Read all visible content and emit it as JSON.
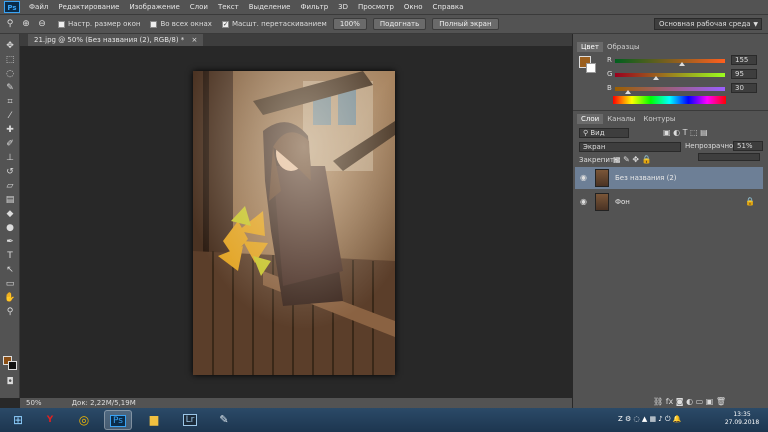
{
  "app": {
    "logo": "Ps"
  },
  "menu": [
    "Файл",
    "Редактирование",
    "Изображение",
    "Слои",
    "Текст",
    "Выделение",
    "Фильтр",
    "3D",
    "Просмотр",
    "Окно",
    "Справка"
  ],
  "options": {
    "resize_windows": "Настр. размер окон",
    "all_windows": "Во всех окнах",
    "scrubby_zoom": "Масшт. перетаскиванием",
    "btn_100": "100%",
    "btn_fit": "Подогнать",
    "btn_fullscreen": "Полный экран",
    "workspace": "Основная рабочая среда"
  },
  "document": {
    "tab_title": "21.jpg @ 50% (Без названия (2), RGB/8) *",
    "close": "×"
  },
  "status": {
    "zoom": "50%",
    "doc_size": "Док: 2,22M/5,19M"
  },
  "color_panel": {
    "tabs": [
      "Цвет",
      "Образцы"
    ],
    "r_label": "R",
    "r_value": "155",
    "g_label": "G",
    "g_value": "95",
    "b_label": "B",
    "b_value": "30",
    "r": 155,
    "g": 95,
    "b": 30,
    "foreground": "#9b5f1e",
    "background": "#ffffff"
  },
  "layers_panel": {
    "tabs": [
      "Слои",
      "Каналы",
      "Контуры"
    ],
    "filter_kind": "Вид",
    "blend_mode": "Экран",
    "opacity_label": "Непрозрачность:",
    "opacity_value": "51%",
    "lock_label": "Закрепить:",
    "layers": [
      {
        "name": "Без названия (2)",
        "selected": true
      },
      {
        "name": "Фон",
        "locked": true
      }
    ]
  },
  "taskbar": {
    "time": "13:35",
    "date": "27.09.2018",
    "apps": [
      "start",
      "yandex",
      "chrome",
      "photoshop",
      "explorer",
      "lightroom",
      "paint"
    ],
    "app_labels": {
      "lightroom": "Lr",
      "photoshop": "Ps"
    }
  }
}
